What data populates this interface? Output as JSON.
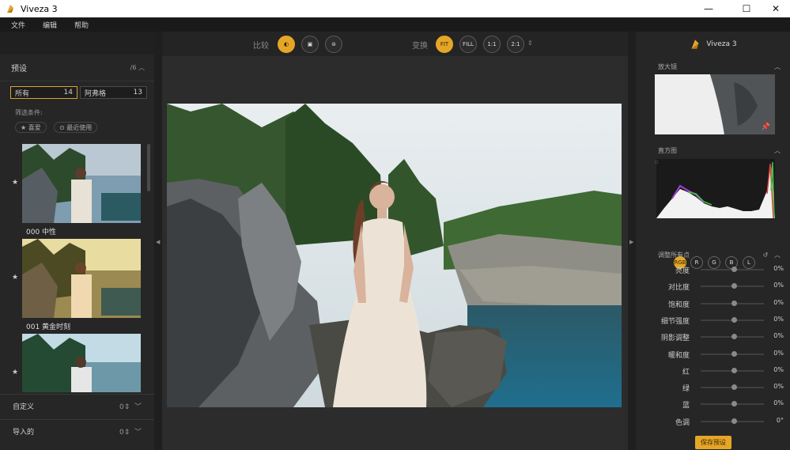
{
  "window": {
    "title": "Viveza 3",
    "minimize": "—",
    "maximize": "☐",
    "close": "✕"
  },
  "menu": [
    "文件",
    "编辑",
    "帮助"
  ],
  "left": {
    "presets_title": "预设",
    "presets_count": "/6",
    "tabs": [
      {
        "label": "所有",
        "count": "14"
      },
      {
        "label": "阿弗格",
        "count": "13"
      }
    ],
    "filter_label": "筛选条件:",
    "filters": [
      "★ 喜爱",
      "⊙ 最近使用"
    ],
    "presets": [
      {
        "label": "000 中性"
      },
      {
        "label": "001 黄金时刻"
      },
      {
        "label": ""
      }
    ],
    "custom_title": "自定义",
    "custom_count": "0",
    "imported_title": "导入的",
    "imported_count": "0"
  },
  "toolbar": {
    "compare_label": "比较",
    "transform_label": "变换",
    "buttons_compare": [
      "◐",
      "▣",
      "⊜"
    ],
    "buttons_zoom": [
      "FIT",
      "FILL",
      "1:1",
      "2:1"
    ]
  },
  "right": {
    "brand": "Viveza 3",
    "loupe_title": "放大镜",
    "histogram_title": "直方图",
    "hist_buttons": [
      "RGB",
      "R",
      "G",
      "B",
      "L"
    ],
    "adjust_title": "调整所有点",
    "sliders": [
      {
        "label": "亮度",
        "value": "0%",
        "level": 0.52
      },
      {
        "label": "对比度",
        "value": "0%",
        "level": 0.52
      },
      {
        "label": "饱和度",
        "value": "0%",
        "level": 0.52
      },
      {
        "label": "细节强度",
        "value": "0%",
        "level": 0.52
      },
      {
        "label": "阴影调整",
        "value": "0%",
        "level": 0.52
      },
      {
        "label": "暖和度",
        "value": "0%",
        "level": 0.52
      },
      {
        "label": "红",
        "value": "0%",
        "level": 0.52
      },
      {
        "label": "绿",
        "value": "0%",
        "level": 0.52
      },
      {
        "label": "蓝",
        "value": "0%",
        "level": 0.52
      },
      {
        "label": "色调",
        "value": "0°",
        "level": 0.52
      }
    ],
    "save_label": "保存预设"
  },
  "colors": {
    "accent": "#e5a628",
    "panel": "#262626",
    "canvas": "#2c2c2c"
  }
}
